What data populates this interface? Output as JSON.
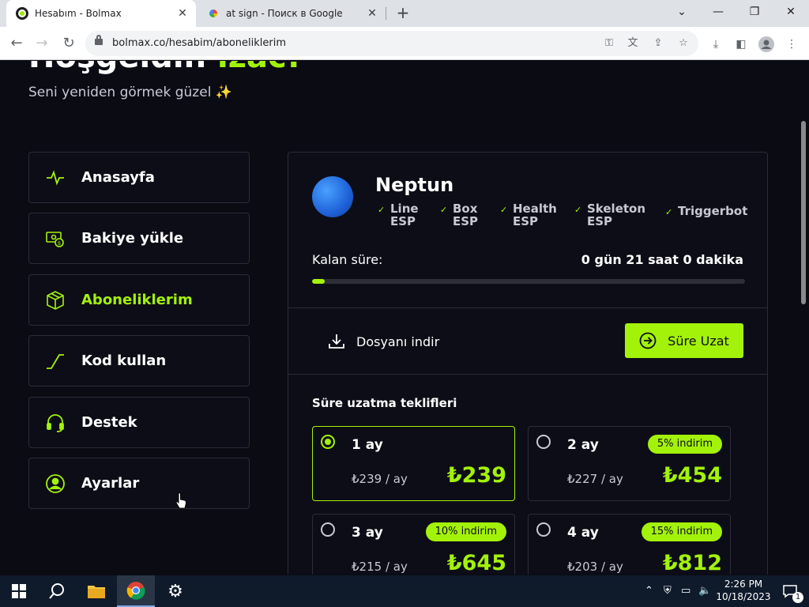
{
  "browser": {
    "tabs": [
      {
        "title": "Hesabım - Bolmax",
        "active": true
      },
      {
        "title": "at sign - Поиск в Google",
        "active": false
      }
    ],
    "url": "bolmax.co/hesabim/aboneliklerim"
  },
  "page": {
    "welcome_prefix": "Hoşgeldin ",
    "welcome_name": "izac!",
    "subtitle": "Seni yeniden görmek güzel ✨",
    "menu": [
      {
        "label": "Anasayfa",
        "icon": "activity-icon"
      },
      {
        "label": "Bakiye yükle",
        "icon": "money-icon"
      },
      {
        "label": "Aboneliklerim",
        "icon": "box-icon",
        "active": true
      },
      {
        "label": "Kod kullan",
        "icon": "code-icon"
      },
      {
        "label": "Destek",
        "icon": "headset-icon"
      },
      {
        "label": "Ayarlar",
        "icon": "user-icon"
      }
    ],
    "product": {
      "name": "Neptun",
      "features": [
        {
          "line1": "Line",
          "line2": "ESP"
        },
        {
          "line1": "Box",
          "line2": "ESP"
        },
        {
          "line1": "Health",
          "line2": "ESP"
        },
        {
          "line1": "Skeleton",
          "line2": "ESP"
        },
        {
          "line1": "Triggerbot",
          "line2": ""
        }
      ],
      "remaining_label": "Kalan süre:",
      "remaining_value": "0 gün 21 saat 0 dakika",
      "progress_fraction": 0.03,
      "download_label": "Dosyanı indir",
      "extend_label": "Süre Uzat"
    },
    "offers_title": "Süre uzatma teklifleri",
    "offers": [
      {
        "period": "1 ay",
        "badge": "",
        "monthly": "₺239 / ay",
        "total": "₺239",
        "selected": true
      },
      {
        "period": "2 ay",
        "badge": "5% indirim",
        "monthly": "₺227 / ay",
        "total": "₺454",
        "selected": false
      },
      {
        "period": "3 ay",
        "badge": "10% indirim",
        "monthly": "₺215 / ay",
        "total": "₺645",
        "selected": false
      },
      {
        "period": "4 ay",
        "badge": "15% indirim",
        "monthly": "₺203 / ay",
        "total": "₺812",
        "selected": false
      }
    ],
    "accent_color": "#a3f20a"
  },
  "taskbar": {
    "time": "2:26 PM",
    "date": "10/18/2023",
    "notification_count": "1"
  }
}
